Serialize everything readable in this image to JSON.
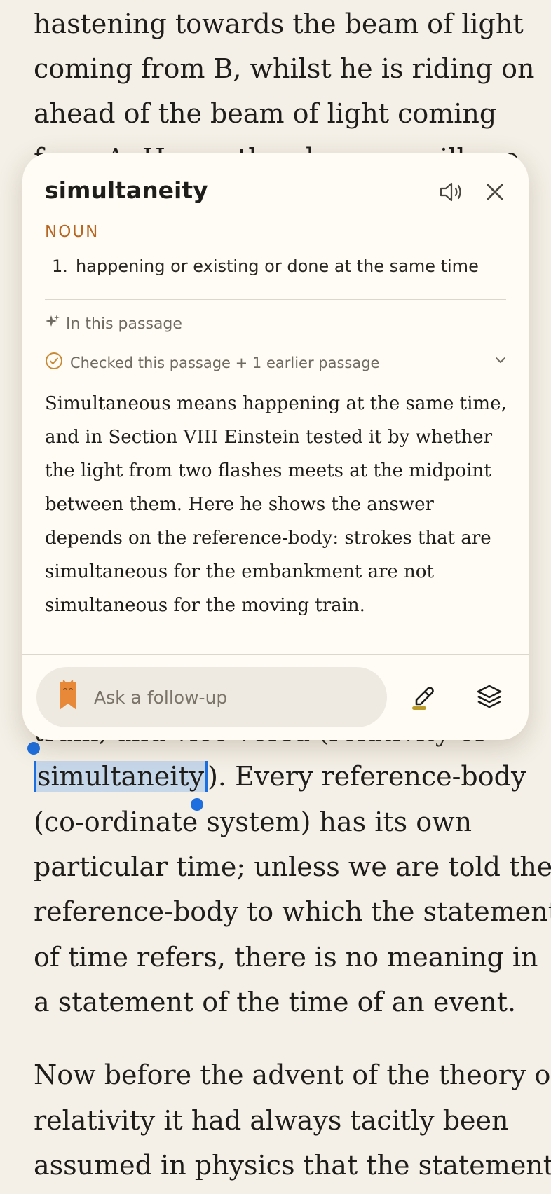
{
  "reader": {
    "lines_top": [
      "hastening towards the beam of light",
      "coming from B, whilst he is riding on",
      "ahead of the beam of light coming",
      "from A. Hence the observer will see"
    ],
    "line_train": "train, and vice versa (relativity of",
    "selected_word": "simultaneity",
    "line_after_selection": "). Every reference-body",
    "lines_bottom": [
      "(co-ordinate system) has its own",
      "particular time; unless we are told the",
      "reference-body to which the statement",
      "of time refers, there is no meaning in",
      "a statement of the time of an event."
    ],
    "paragraph2": [
      "Now before the advent of the theory of",
      "relativity it had always tacitly been",
      "assumed in physics that the statement"
    ]
  },
  "popup": {
    "word": "simultaneity",
    "part_of_speech": "NOUN",
    "definition_number": "1.",
    "definition": "happening or existing or done at the same time",
    "section_label": "In this passage",
    "checked_text": "Checked this passage + 1 earlier passage",
    "explanation": "Simultaneous means happening at the same time, and in Section VIII Einstein tested it by whether the light from two flashes meets at the midpoint between them. Here he shows the answer depends on the reference-body: strokes that are simultaneous for the embankment are not simultaneous for the moving train.",
    "ask_placeholder": "Ask a follow-up",
    "icons": {
      "speaker": "speaker-icon",
      "close": "close-icon",
      "sparkle": "sparkle-icon",
      "check": "check-circle-icon",
      "chevron": "chevron-down-icon",
      "bookmark": "bookmark-mascot-icon",
      "highlight": "highlighter-icon",
      "layers": "layers-icon"
    }
  },
  "colors": {
    "page_bg": "#f4f0e7",
    "popup_bg": "#fffcf5",
    "accent_pos": "#b7651f",
    "selection": "#c7d7ea",
    "handle": "#1d6fe0"
  }
}
